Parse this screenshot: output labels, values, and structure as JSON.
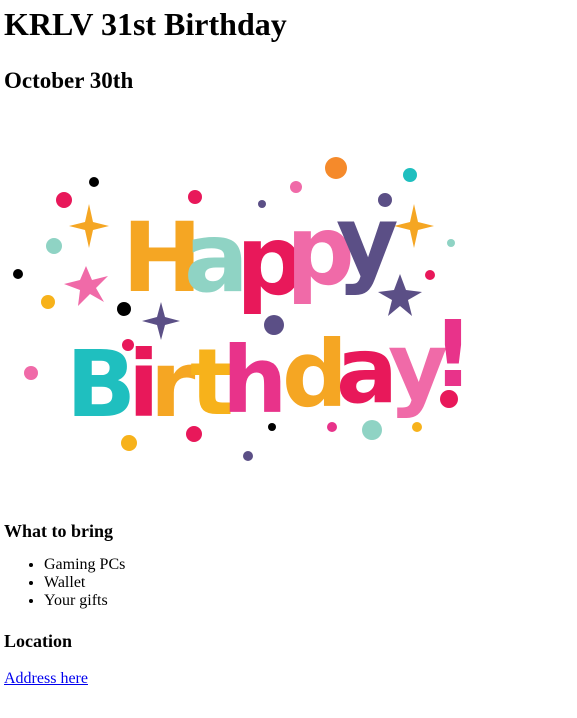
{
  "page": {
    "title": "KRLV 31st Birthday",
    "date": "October 30th"
  },
  "banner": {
    "word1": "Happy",
    "word2": "Birthday!",
    "colors": [
      "#f5a623",
      "#1fbfbf",
      "#e8185a",
      "#f06aa8",
      "#5b4f86",
      "#8fd3c4",
      "#f7b21b",
      "#e8338a"
    ]
  },
  "bring": {
    "heading": "What to bring",
    "items": [
      "Gaming PCs",
      "Wallet",
      "Your gifts"
    ]
  },
  "location": {
    "heading": "Location",
    "link_text": "Address here",
    "link_color": "#0000ee"
  }
}
